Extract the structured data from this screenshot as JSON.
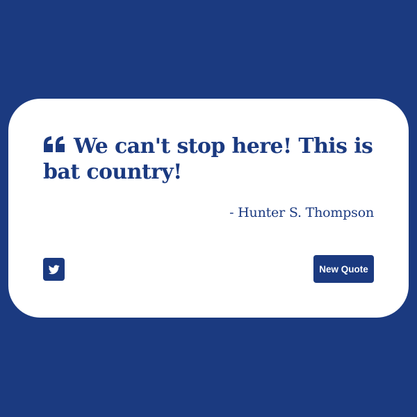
{
  "colors": {
    "background": "#1b3a80",
    "card": "#ffffff",
    "accent": "#1b3a80",
    "button_text": "#ffffff"
  },
  "quote": {
    "icon": "quote-left-icon",
    "text": "We can't stop here! This is bat country!",
    "author": "- Hunter S. Thompson"
  },
  "actions": {
    "tweet_icon": "twitter-icon",
    "new_quote_label": "New Quote"
  }
}
